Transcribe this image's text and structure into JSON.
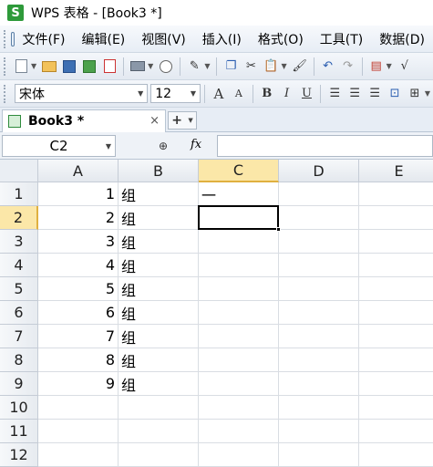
{
  "window": {
    "logo_letter": "S",
    "title": "WPS 表格 - [Book3 *]"
  },
  "menu": {
    "items": [
      "文件(F)",
      "编辑(E)",
      "视图(V)",
      "插入(I)",
      "格式(O)",
      "工具(T)",
      "数据(D)"
    ]
  },
  "toolbar_format": {
    "font_name": "宋体",
    "font_size": "12",
    "grow_font": "A",
    "shrink_font": "A",
    "bold": "B",
    "italic": "I",
    "underline": "U"
  },
  "tabs": {
    "active_title": "Book3 *",
    "close_glyph": "×",
    "add_glyph": "+"
  },
  "formula_bar": {
    "name_box": "C2",
    "fx_label": "fx",
    "content": ""
  },
  "sheet": {
    "columns": [
      "A",
      "B",
      "C",
      "D",
      "E"
    ],
    "rows": [
      "1",
      "2",
      "3",
      "4",
      "5",
      "6",
      "7",
      "8",
      "9",
      "10",
      "11",
      "12"
    ],
    "active_column": "C",
    "active_row": "2",
    "cells": {
      "A1": "1",
      "B1": "组",
      "C1": "一",
      "A2": "2",
      "B2": "组",
      "A3": "3",
      "B3": "组",
      "A4": "4",
      "B4": "组",
      "A5": "5",
      "B5": "组",
      "A6": "6",
      "B6": "组",
      "A7": "7",
      "B7": "组",
      "A8": "8",
      "B8": "组",
      "A9": "9",
      "B9": "组"
    }
  }
}
